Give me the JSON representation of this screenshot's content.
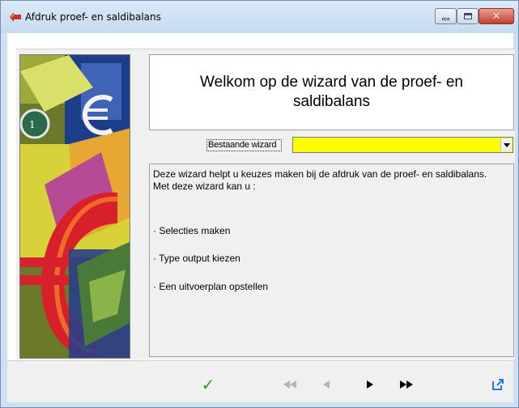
{
  "window": {
    "title": "Afdruk proef- en saldibalans"
  },
  "wizard": {
    "welcome_title": "Welkom op de wizard van de proef- en saldibalans",
    "existing_wizard_label": "Bestaande wizard",
    "existing_wizard_value": "",
    "existing_wizard_highlight": "#ffff00",
    "description_intro": "Deze wizard helpt u keuzes maken bij de afdruk van de proef- en saldibalans. Met deze wizard kan u :",
    "items": [
      "· Selecties maken",
      "· Type output kiezen",
      "· Een uitvoerplan opstellen"
    ]
  },
  "toolbar": {
    "finish_icon": "checkmark-icon",
    "first_icon": "first-icon",
    "previous_icon": "previous-icon",
    "next_icon": "next-icon",
    "last_icon": "last-icon",
    "export_icon": "external-link-icon",
    "finish_color": "#2e9b1c",
    "accent": "#1e7bd8"
  }
}
